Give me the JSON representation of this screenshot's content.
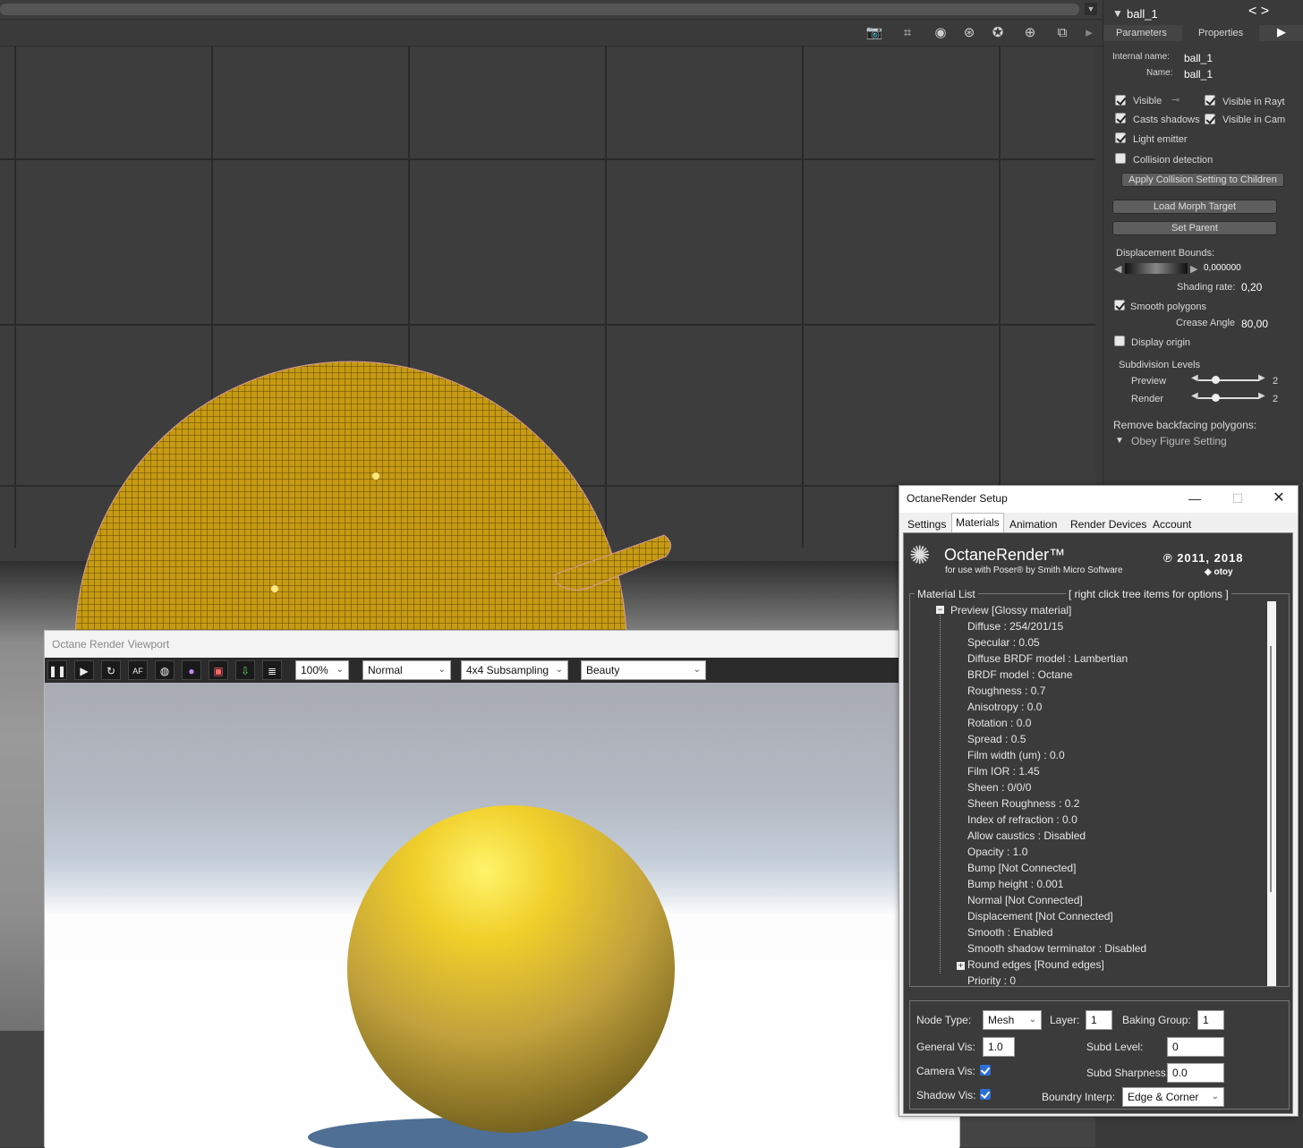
{
  "right_panel": {
    "object_name": "ball_1",
    "tabs": [
      "Parameters",
      "Properties"
    ],
    "internal_name_label": "Internal name:",
    "internal_name_value": "ball_1",
    "name_label": "Name:",
    "name_value": "ball_1",
    "visible": "Visible",
    "visible_raytrace": "Visible in Rayt",
    "casts_shadows": "Casts shadows",
    "visible_camera": "Visible in Cam",
    "light_emitter": "Light emitter",
    "collision_detection": "Collision detection",
    "apply_collision": "Apply Collision Setting to Children",
    "load_morph": "Load Morph Target",
    "set_parent": "Set Parent",
    "displacement_bounds": "Displacement Bounds:",
    "displacement_value": "0,000000",
    "shading_rate_label": "Shading rate:",
    "shading_rate_value": "0,20",
    "smooth_polygons": "Smooth polygons",
    "crease_angle_label": "Crease Angle",
    "crease_angle_value": "80,00",
    "display_origin": "Display origin",
    "subdivision_levels": "Subdivision Levels",
    "preview_label": "Preview",
    "preview_value": "2",
    "render_label": "Render",
    "render_value": "2",
    "remove_backfacing": "Remove backfacing polygons:",
    "obey_figure": "Obey Figure Setting"
  },
  "render_viewport": {
    "title": "Octane Render Viewport",
    "zoom": "100%",
    "mode": "Normal",
    "subsampling": "4x4 Subsampling",
    "pass": "Beauty",
    "icons": [
      "pause-icon",
      "play-icon",
      "restart-icon",
      "af-icon",
      "camera-icon",
      "color-icon",
      "region-icon",
      "export-icon",
      "log-icon"
    ]
  },
  "setup_window": {
    "title": "OctaneRender Setup",
    "tabs": [
      "Settings",
      "Materials",
      "Animation",
      "Render Devices",
      "Account"
    ],
    "brand": "OctaneRender™",
    "brand_sub": "for use with Poser® by Smith Micro Software",
    "copyright": "℗ 2011, 2018",
    "otoy": "otoy",
    "material_list_label": "Material List",
    "hint": "[ right click tree items for options ]",
    "tree_root": "Preview   [Glossy material]",
    "tree_items": [
      "Diffuse  :  254/201/15",
      "Specular  :  0.05",
      "Diffuse BRDF model  :  Lambertian",
      "BRDF model  :  Octane",
      "Roughness  :  0.7",
      "Anisotropy  :  0.0",
      "Rotation  :  0.0",
      "Spread  :  0.5",
      "Film width (um)  :  0.0",
      "Film IOR  :  1.45",
      "Sheen  :  0/0/0",
      "Sheen Roughness  :  0.2",
      "Index of refraction  :  0.0",
      "Allow caustics  :  Disabled",
      "Opacity  :  1.0",
      "Bump   [Not Connected]",
      "Bump height  :  0.001",
      "Normal   [Not Connected]",
      "Displacement   [Not Connected]",
      "Smooth  :  Enabled",
      "Smooth shadow terminator  :  Disabled",
      "Round edges   [Round edges]",
      "Priority  :  0"
    ],
    "node_type_label": "Node Type:",
    "node_type_value": "Mesh",
    "layer_label": "Layer:",
    "layer_value": "1",
    "baking_group_label": "Baking Group:",
    "baking_group_value": "1",
    "general_vis_label": "General Vis:",
    "general_vis_value": "1.0",
    "subd_level_label": "Subd Level:",
    "subd_level_value": "0",
    "camera_vis_label": "Camera Vis:",
    "subd_sharpness_label": "Subd Sharpness:",
    "subd_sharpness_value": "0.0",
    "shadow_vis_label": "Shadow Vis:",
    "boundary_interp_label": "Boundry Interp:",
    "boundary_interp_value": "Edge & Corner"
  },
  "colors": {
    "ball": "#f2c21e",
    "ball_dark": "#6f5708",
    "panel_bg": "#3a3a3a"
  }
}
